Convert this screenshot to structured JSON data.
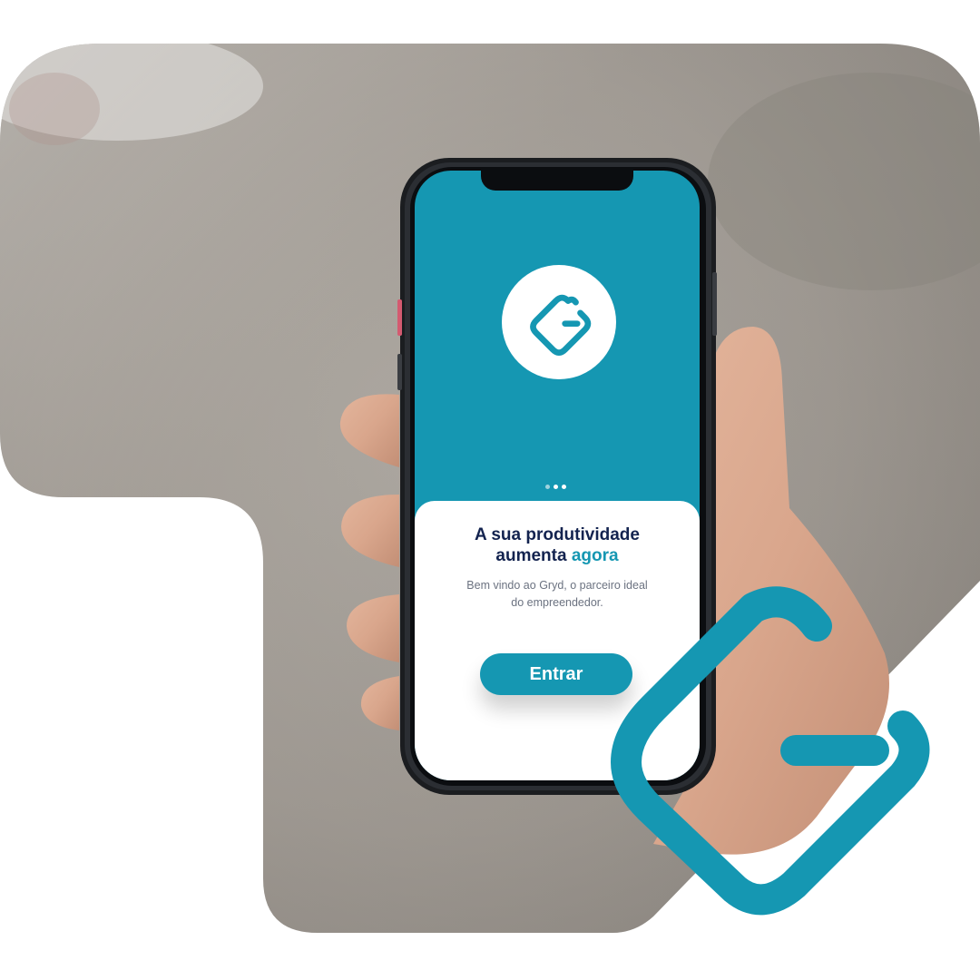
{
  "onboarding": {
    "headline_line1": "A sua produtividade",
    "headline_line2": "aumenta",
    "headline_accent": "agora",
    "subtitle_line1": "Bem vindo ao Gryd, o parceiro ideal",
    "subtitle_line2": "do empreendedor.",
    "button_label": "Entrar"
  },
  "pagination": {
    "total": 3,
    "active_index": 2
  },
  "icons": {
    "app_logo": "gryd-logo-icon",
    "brand_mark": "gryd-brand-mark-icon"
  },
  "colors": {
    "brand_teal": "#1597b2",
    "navy_text": "#13234f",
    "gray_text": "#6b7280",
    "background": "#ffffff"
  }
}
